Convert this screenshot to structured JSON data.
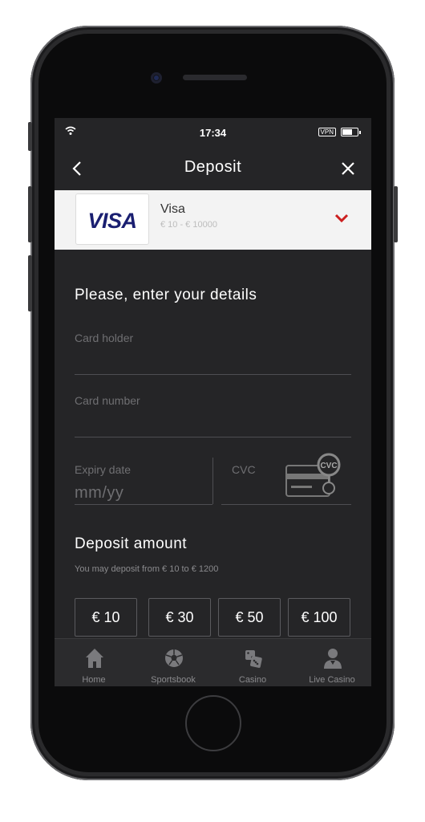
{
  "status_bar": {
    "time": "17:34",
    "vpn": "VPN"
  },
  "header": {
    "title": "Deposit"
  },
  "payment_method": {
    "logo_text": "VISA",
    "name": "Visa",
    "range": "€ 10 - € 10000"
  },
  "form": {
    "title": "Please, enter your details",
    "card_holder_placeholder": "Card holder",
    "card_number_placeholder": "Card number",
    "expiry_label": "Expiry date",
    "expiry_placeholder": "mm/yy",
    "cvc_label": "CVC",
    "cvc_badge": "CVC"
  },
  "deposit": {
    "title": "Deposit amount",
    "hint": "You may deposit from € 10 to € 1200",
    "amounts": [
      "€ 10",
      "€ 30",
      "€ 50",
      "€ 100"
    ]
  },
  "tabbar": {
    "items": [
      {
        "label": "Home",
        "icon": "home-icon"
      },
      {
        "label": "Sportsbook",
        "icon": "soccer-ball-icon"
      },
      {
        "label": "Casino",
        "icon": "dice-icon"
      },
      {
        "label": "Live Casino",
        "icon": "dealer-icon"
      }
    ]
  },
  "colors": {
    "accent_red": "#cc1f1f",
    "screen_bg": "#252527",
    "visa_blue": "#1a1f71"
  }
}
